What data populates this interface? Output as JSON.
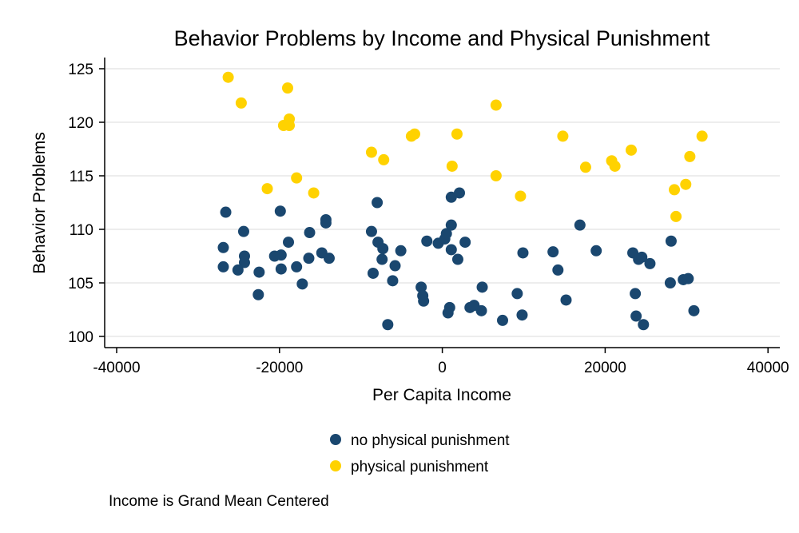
{
  "chart_data": {
    "type": "scatter",
    "title": "Behavior Problems by Income and Physical Punishment",
    "xlabel": "Per Capita Income",
    "ylabel": "Behavior Problems",
    "xlim": [
      -41000,
      41500
    ],
    "ylim": [
      99,
      126
    ],
    "xticks": [
      -40000,
      -20000,
      0,
      20000,
      40000
    ],
    "xtick_labels": [
      "-40000",
      "-20000",
      "0",
      "20000",
      "40000"
    ],
    "yticks": [
      100,
      105,
      110,
      115,
      120,
      125
    ],
    "ytick_labels": [
      "100",
      "105",
      "110",
      "115",
      "120",
      "125"
    ],
    "grid": "horizontal",
    "legend_position": "bottom",
    "note": "Income is Grand Mean Centered",
    "series": [
      {
        "name": "no physical punishment",
        "color": "#1a476f",
        "points": [
          [
            -26600,
            111.6
          ],
          [
            -19900,
            111.7
          ],
          [
            -24400,
            109.8
          ],
          [
            -14300,
            110.9
          ],
          [
            -14300,
            110.6
          ],
          [
            -16300,
            109.7
          ],
          [
            -26900,
            108.3
          ],
          [
            -18900,
            108.8
          ],
          [
            -24300,
            107.5
          ],
          [
            -20600,
            107.5
          ],
          [
            -19800,
            107.6
          ],
          [
            -14800,
            107.8
          ],
          [
            -13900,
            107.3
          ],
          [
            -16400,
            107.3
          ],
          [
            -26900,
            106.5
          ],
          [
            -24300,
            106.9
          ],
          [
            -25100,
            106.2
          ],
          [
            -22500,
            106.0
          ],
          [
            -19800,
            106.3
          ],
          [
            -17900,
            106.5
          ],
          [
            -17200,
            104.9
          ],
          [
            -22600,
            103.9
          ],
          [
            -8000,
            112.5
          ],
          [
            1100,
            113.0
          ],
          [
            2100,
            113.4
          ],
          [
            -8700,
            109.8
          ],
          [
            -7900,
            108.8
          ],
          [
            -7300,
            108.2
          ],
          [
            -5100,
            108.0
          ],
          [
            -7400,
            107.2
          ],
          [
            -5800,
            106.6
          ],
          [
            -8500,
            105.9
          ],
          [
            -6100,
            105.2
          ],
          [
            -6700,
            101.1
          ],
          [
            -1900,
            108.9
          ],
          [
            -500,
            108.7
          ],
          [
            300,
            109.1
          ],
          [
            500,
            109.6
          ],
          [
            1100,
            110.4
          ],
          [
            1100,
            108.1
          ],
          [
            2800,
            108.8
          ],
          [
            1900,
            107.2
          ],
          [
            -2600,
            104.6
          ],
          [
            -2400,
            103.8
          ],
          [
            -2300,
            103.3
          ],
          [
            900,
            102.7
          ],
          [
            700,
            102.2
          ],
          [
            3400,
            102.7
          ],
          [
            3900,
            102.9
          ],
          [
            4800,
            102.4
          ],
          [
            4900,
            104.6
          ],
          [
            7400,
            101.5
          ],
          [
            9800,
            102.0
          ],
          [
            9200,
            104.0
          ],
          [
            9900,
            107.8
          ],
          [
            13600,
            107.9
          ],
          [
            14200,
            106.2
          ],
          [
            15200,
            103.4
          ],
          [
            16900,
            110.4
          ],
          [
            18900,
            108.0
          ],
          [
            23400,
            107.8
          ],
          [
            24100,
            107.2
          ],
          [
            24500,
            107.4
          ],
          [
            25500,
            106.8
          ],
          [
            23700,
            104.0
          ],
          [
            23800,
            101.9
          ],
          [
            24700,
            101.1
          ],
          [
            28100,
            108.9
          ],
          [
            28000,
            105.0
          ],
          [
            29600,
            105.3
          ],
          [
            30200,
            105.4
          ],
          [
            30900,
            102.4
          ]
        ]
      },
      {
        "name": "physical punishment",
        "color": "#ffd200",
        "points": [
          [
            -26300,
            124.2
          ],
          [
            -24700,
            121.8
          ],
          [
            -19000,
            123.2
          ],
          [
            -18800,
            120.3
          ],
          [
            -19500,
            119.7
          ],
          [
            -18800,
            119.7
          ],
          [
            -21500,
            113.8
          ],
          [
            -17900,
            114.8
          ],
          [
            -15800,
            113.4
          ],
          [
            -8700,
            117.2
          ],
          [
            -7200,
            116.5
          ],
          [
            -3800,
            118.7
          ],
          [
            -3400,
            118.9
          ],
          [
            1800,
            118.9
          ],
          [
            1200,
            115.9
          ],
          [
            6600,
            121.6
          ],
          [
            6600,
            115.0
          ],
          [
            9600,
            113.1
          ],
          [
            14800,
            118.7
          ],
          [
            17600,
            115.8
          ],
          [
            20800,
            116.4
          ],
          [
            21200,
            115.9
          ],
          [
            23200,
            117.4
          ],
          [
            28500,
            113.7
          ],
          [
            28700,
            111.2
          ],
          [
            29900,
            114.2
          ],
          [
            30400,
            116.8
          ],
          [
            31900,
            118.7
          ]
        ]
      }
    ]
  }
}
